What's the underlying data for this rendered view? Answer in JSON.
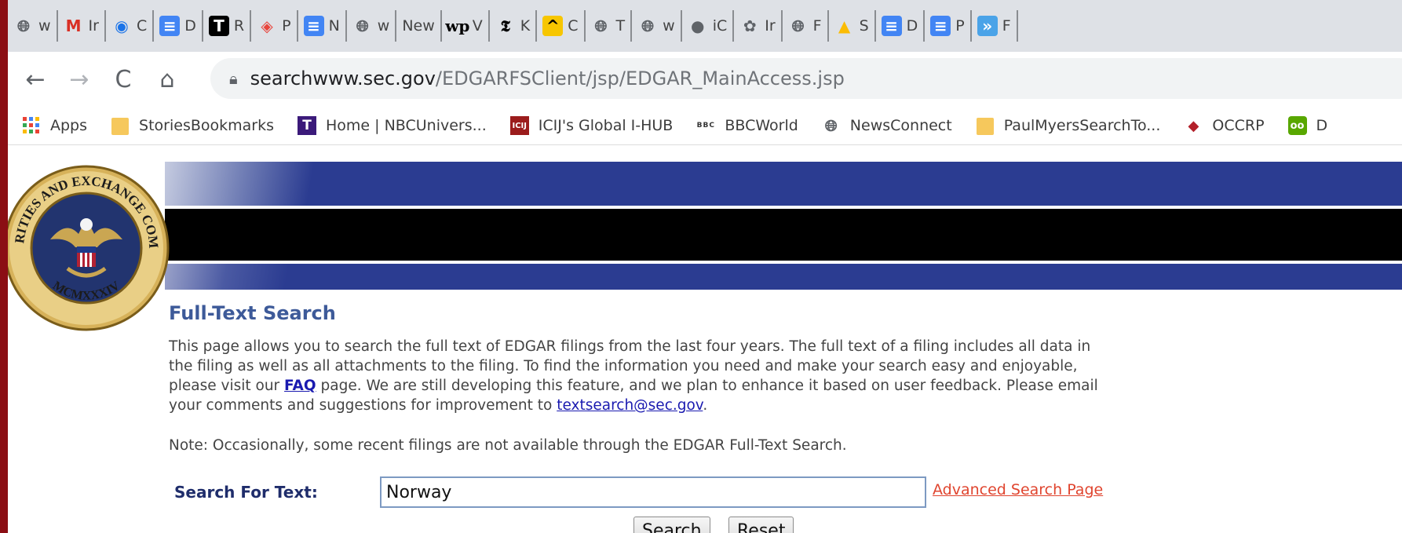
{
  "browser": {
    "tabs": [
      {
        "icon": "globe-icon",
        "label": "w",
        "color": "#5f6368"
      },
      {
        "icon": "gmail-icon",
        "label": "Ir",
        "color": "#d93025"
      },
      {
        "icon": "eye-icon",
        "label": "C",
        "color": "#1a73e8"
      },
      {
        "icon": "docs-icon",
        "label": "D",
        "color": "#4285f4"
      },
      {
        "icon": "t-logo-icon",
        "label": "R",
        "color": "#000000"
      },
      {
        "icon": "diamond-icon",
        "label": "P",
        "color": "#e8453c"
      },
      {
        "icon": "docs-icon",
        "label": "N",
        "color": "#4285f4"
      },
      {
        "icon": "globe-icon",
        "label": "w",
        "color": "#5f6368"
      },
      {
        "icon": "",
        "label": "New",
        "color": "#5f6368"
      },
      {
        "icon": "wp-logo-icon",
        "label": "V",
        "color": "#000000"
      },
      {
        "icon": "nyt-logo-icon",
        "label": "K",
        "color": "#000000"
      },
      {
        "icon": "chevron-up-icon",
        "label": "C",
        "color": "#f7c600"
      },
      {
        "icon": "globe-icon",
        "label": "T",
        "color": "#5f6368"
      },
      {
        "icon": "globe-icon",
        "label": "w",
        "color": "#5f6368"
      },
      {
        "icon": "apple-icon",
        "label": "iC",
        "color": "#5f6368"
      },
      {
        "icon": "openai-icon",
        "label": "Ir",
        "color": "#5f6368"
      },
      {
        "icon": "globe-icon",
        "label": "F",
        "color": "#5f6368"
      },
      {
        "icon": "drive-icon",
        "label": "S",
        "color": "#fbbc04"
      },
      {
        "icon": "docs-icon",
        "label": "D",
        "color": "#4285f4"
      },
      {
        "icon": "docs-icon",
        "label": "P",
        "color": "#4285f4"
      },
      {
        "icon": "double-chevron-icon",
        "label": "F",
        "color": "#4aa3e8"
      }
    ],
    "nav": {
      "back": "←",
      "forward": "→",
      "reload": "C",
      "home": "⌂"
    },
    "url_host": "searchwww.sec.gov",
    "url_path": "/EDGARFSClient/jsp/EDGAR_MainAccess.jsp",
    "bookmarks": [
      {
        "icon": "apps-grid-icon",
        "label": "Apps"
      },
      {
        "icon": "folder-icon",
        "label": "StoriesBookmarks"
      },
      {
        "icon": "t-logo-icon",
        "label": "Home | NBCUnivers..."
      },
      {
        "icon": "icij-logo-icon",
        "label": "ICIJ's Global I-HUB"
      },
      {
        "icon": "bbc-logo-icon",
        "label": "BBCWorld"
      },
      {
        "icon": "globe-icon",
        "label": "NewsConnect"
      },
      {
        "icon": "folder-icon",
        "label": "PaulMyersSearchTo..."
      },
      {
        "icon": "occrp-logo-icon",
        "label": "OCCRP"
      },
      {
        "icon": "owl-icon",
        "label": "D"
      }
    ]
  },
  "page": {
    "seal_text": "U.S. SECURITIES AND EXCHANGE COMMISSION",
    "seal_year": "MCMXXXIV",
    "title": "Full-Text Search",
    "intro_1": "This page allows you to search the full text of EDGAR filings from the last four years. The full text of a filing includes all data in the filing as well as all attachments to the filing. To find the information you need and make your search easy and enjoyable, please visit our ",
    "faq_link": "FAQ",
    "intro_2": " page. We are still developing this feature, and we plan to enhance it based on user feedback. Please email your comments and suggestions for improvement to ",
    "email_link": "textsearch@sec.gov",
    "intro_3": ".",
    "note": "Note: Occasionally, some recent filings are not available through the EDGAR Full-Text Search.",
    "search_label": "Search For Text:",
    "search_value": "Norway",
    "advanced_link": "Advanced Search Page",
    "search_button": "Search",
    "reset_button": "Reset"
  },
  "colors": {
    "frame": "#8b0e14",
    "banner_blue": "#2b3c91",
    "title_blue": "#3d5a99",
    "link_orange": "#e0452f"
  }
}
